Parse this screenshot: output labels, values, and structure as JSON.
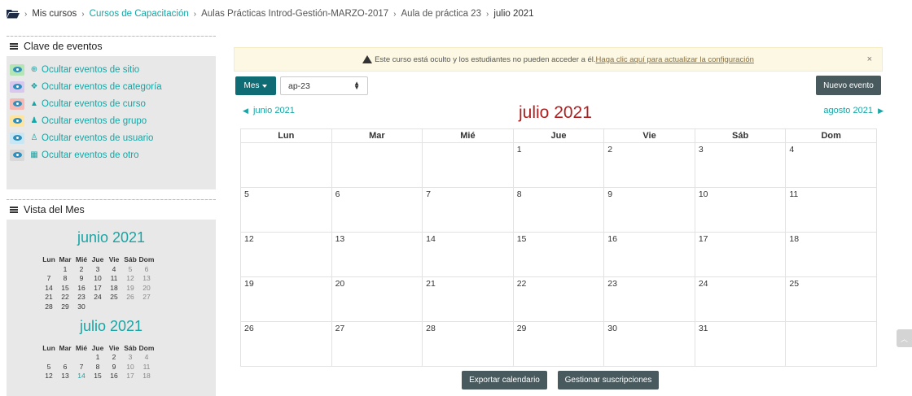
{
  "breadcrumb": {
    "items": [
      {
        "label": "Mis cursos",
        "style": "plain"
      },
      {
        "label": "Cursos de Capacitación",
        "style": "link"
      },
      {
        "label": "Aulas Prácticas Introd-Gestión-MARZO-2017",
        "style": "muted"
      },
      {
        "label": "Aula de práctica 23",
        "style": "muted"
      },
      {
        "label": "julio 2021",
        "style": "plain"
      }
    ]
  },
  "legend": {
    "title": "Clave de eventos",
    "items": [
      {
        "label": "Ocultar eventos de sitio",
        "icon": "globe-icon",
        "glyph": "⊕",
        "color": "#b4e6b4"
      },
      {
        "label": "Ocultar eventos de categoría",
        "icon": "cubes-icon",
        "glyph": "❖",
        "color": "#d9c8ee"
      },
      {
        "label": "Ocultar eventos de curso",
        "icon": "graduation-cap-icon",
        "glyph": "▲",
        "color": "#f7b9b3"
      },
      {
        "label": "Ocultar eventos de grupo",
        "icon": "users-icon",
        "glyph": "♟",
        "color": "#fde5a0"
      },
      {
        "label": "Ocultar eventos de usuario",
        "icon": "user-icon",
        "glyph": "♙",
        "color": "#c9e6f5"
      },
      {
        "label": "Ocultar eventos de otro",
        "icon": "calendar-icon",
        "glyph": "▦",
        "color": "#d8d8d8"
      }
    ]
  },
  "month_view": {
    "title": "Vista del Mes",
    "weekdays": [
      "Lun",
      "Mar",
      "Mié",
      "Jue",
      "Vie",
      "Sáb",
      "Dom"
    ],
    "june": {
      "title": "junio 2021",
      "weeks": [
        [
          "",
          "1",
          "2",
          "3",
          "4",
          "5",
          "6"
        ],
        [
          "7",
          "8",
          "9",
          "10",
          "11",
          "12",
          "13"
        ],
        [
          "14",
          "15",
          "16",
          "17",
          "18",
          "19",
          "20"
        ],
        [
          "21",
          "22",
          "23",
          "24",
          "25",
          "26",
          "27"
        ],
        [
          "28",
          "29",
          "30",
          "",
          "",
          "",
          ""
        ]
      ]
    },
    "july": {
      "title": "julio 2021",
      "weeks": [
        [
          "",
          "",
          "",
          "1",
          "2",
          "3",
          "4"
        ],
        [
          "5",
          "6",
          "7",
          "8",
          "9",
          "10",
          "11"
        ],
        [
          "12",
          "13",
          "14",
          "15",
          "16",
          "17",
          "18"
        ]
      ]
    }
  },
  "alert": {
    "text": "Este curso está oculto y los estudiantes no pueden acceder a él.",
    "link": "Haga clic aquí para actualizar la configuración",
    "close": "×"
  },
  "controls": {
    "view_button": "Mes",
    "course_select": "ap-23",
    "new_event_button": "Nuevo evento"
  },
  "calendar": {
    "title": "julio 2021",
    "prev_label": "junio 2021",
    "next_label": "agosto 2021",
    "weekdays": [
      "Lun",
      "Mar",
      "Mié",
      "Jue",
      "Vie",
      "Sáb",
      "Dom"
    ],
    "weeks": [
      [
        "",
        "",
        "",
        "1",
        "2",
        "3",
        "4"
      ],
      [
        "5",
        "6",
        "7",
        "8",
        "9",
        "10",
        "11"
      ],
      [
        "12",
        "13",
        "14",
        "15",
        "16",
        "17",
        "18"
      ],
      [
        "19",
        "20",
        "21",
        "22",
        "23",
        "24",
        "25"
      ],
      [
        "26",
        "27",
        "28",
        "29",
        "30",
        "31",
        ""
      ]
    ]
  },
  "footer": {
    "export_button": "Exportar calendario",
    "subscriptions_button": "Gestionar suscripciones"
  }
}
